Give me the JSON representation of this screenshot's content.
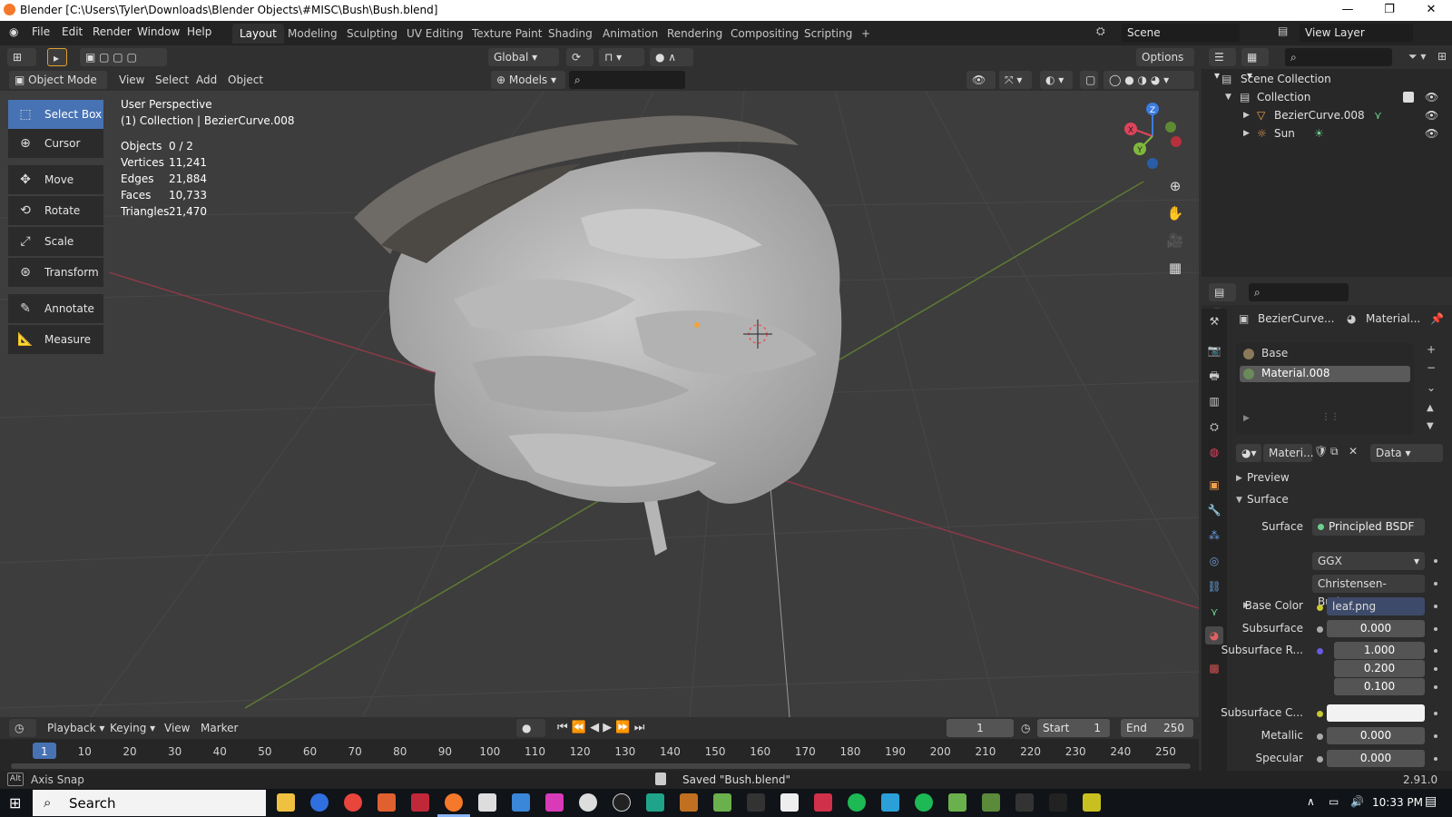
{
  "window": {
    "title": "Blender [C:\\Users\\Tyler\\Downloads\\Blender Objects\\#MISC\\Bush\\Bush.blend]",
    "minimize": "—",
    "maximize": "❐",
    "close": "✕"
  },
  "menu": {
    "file": "File",
    "edit": "Edit",
    "render": "Render",
    "window": "Window",
    "help": "Help"
  },
  "workspaces": [
    "Layout",
    "Modeling",
    "Sculpting",
    "UV Editing",
    "Texture Paint",
    "Shading",
    "Animation",
    "Rendering",
    "Compositing",
    "Scripting"
  ],
  "scene": {
    "scene_name": "Scene",
    "view_layer": "View Layer"
  },
  "viewport_header": {
    "transform_orientation": "Global",
    "options": "Options",
    "mode": "Object Mode",
    "view": "View",
    "select": "Select",
    "add": "Add",
    "object": "Object",
    "collection_filter": "Models"
  },
  "tools": [
    "Select Box",
    "Cursor",
    "Move",
    "Rotate",
    "Scale",
    "Transform",
    "Annotate",
    "Measure"
  ],
  "overlay": {
    "perspective": "User Perspective",
    "context": "(1) Collection | BezierCurve.008",
    "stats": [
      {
        "k": "Objects",
        "v": "0 / 2"
      },
      {
        "k": "Vertices",
        "v": "11,241"
      },
      {
        "k": "Edges",
        "v": "21,884"
      },
      {
        "k": "Faces",
        "v": "10,733"
      },
      {
        "k": "Triangles",
        "v": "21,470"
      }
    ]
  },
  "gizmo": {
    "x": "X",
    "y": "Y",
    "z": "Z"
  },
  "timeline": {
    "playback": "Playback",
    "keying": "Keying",
    "view": "View",
    "marker": "Marker",
    "current_frame": "1",
    "start_label": "Start",
    "start": "1",
    "end_label": "End",
    "end": "250",
    "ticks": [
      "1",
      "10",
      "20",
      "30",
      "40",
      "50",
      "60",
      "70",
      "80",
      "90",
      "100",
      "110",
      "120",
      "130",
      "140",
      "150",
      "160",
      "170",
      "180",
      "190",
      "200",
      "210",
      "220",
      "230",
      "240",
      "250"
    ]
  },
  "statusbar": {
    "key": "Alt",
    "hint": "Axis Snap",
    "message": "Saved \"Bush.blend\"",
    "version": "2.91.0"
  },
  "outliner": {
    "scene_collection": "Scene Collection",
    "collection": "Collection",
    "items": [
      "BezierCurve.008",
      "Sun"
    ]
  },
  "properties": {
    "object_name": "BezierCurve...",
    "material_name": "Material...",
    "slots": [
      "Base",
      "Material.008"
    ],
    "material_field": "Materi...",
    "link": "Data",
    "preview": "Preview",
    "surface_panel": "Surface",
    "surface_label": "Surface",
    "surface_value": "Principled BSDF",
    "distribution": "GGX",
    "subsurface_method": "Christensen-Burley",
    "base_color_label": "Base Color",
    "base_color_value": "leaf.png",
    "subsurface_label": "Subsurface",
    "subsurface_value": "0.000",
    "subsurface_radius_label": "Subsurface R...",
    "subsurface_radius": [
      "1.000",
      "0.200",
      "0.100"
    ],
    "subsurface_color_label": "Subsurface C...",
    "metallic_label": "Metallic",
    "metallic_value": "0.000",
    "specular_label": "Specular",
    "specular_value": "0.000"
  },
  "taskbar": {
    "search": "Search",
    "time": "10:33 PM"
  },
  "colors": {
    "accent": "#4772b3",
    "x_axis": "#e0435c",
    "y_axis": "#7fb83c",
    "z_axis": "#3c7be0"
  }
}
